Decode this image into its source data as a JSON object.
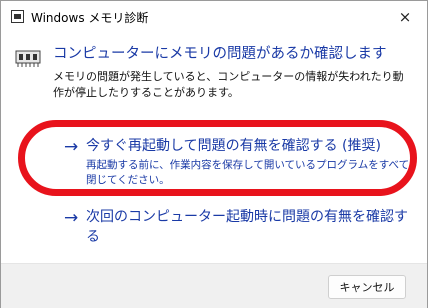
{
  "window": {
    "title": "Windows メモリ診断"
  },
  "dialog": {
    "heading": "コンピューターにメモリの問題があるか確認します",
    "description": "メモリの問題が発生していると、コンピューターの情報が失われたり動作が停止したりすることがあります。",
    "options": [
      {
        "arrow": "→",
        "label": "今すぐ再起動して問題の有無を確認する (推奨)",
        "sublabel": "再起動する前に、作業内容を保存して開いているプログラムをすべて閉じてください。"
      },
      {
        "arrow": "→",
        "label": "次回のコンピューター起動時に問題の有無を確認する",
        "sublabel": ""
      }
    ]
  },
  "footer": {
    "cancel_label": "キャンセル"
  },
  "icons": {
    "close": "×"
  },
  "colors": {
    "link_blue": "#1a3aa6",
    "highlight_red": "#e8131c",
    "footer_bg": "#f0f0f0"
  }
}
